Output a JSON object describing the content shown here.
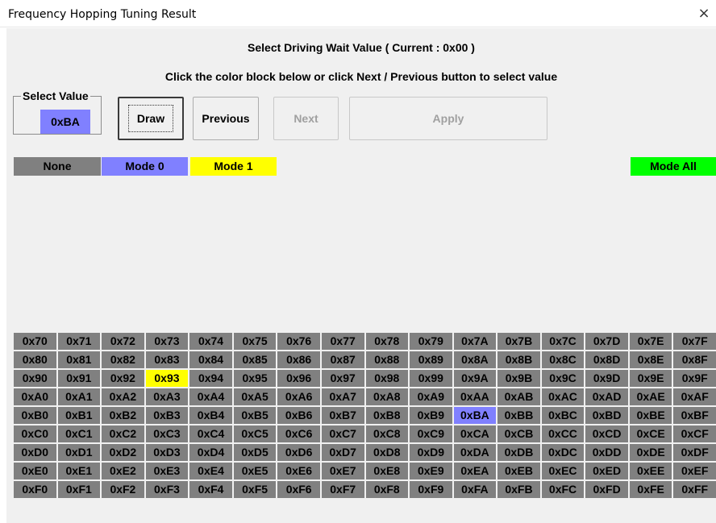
{
  "window": {
    "title": "Frequency Hopping Tuning Result",
    "close_glyph": "×"
  },
  "header": {
    "line1": "Select Driving Wait Value ( Current : 0x00 )",
    "line2": "Click the color block below or click Next / Previous button to select value"
  },
  "select_value": {
    "label": "Select Value",
    "value": "0xBA",
    "color": "#8080ff"
  },
  "buttons": {
    "draw": "Draw",
    "previous": "Previous",
    "next": "Next",
    "apply": "Apply",
    "next_enabled": false,
    "apply_enabled": false
  },
  "legend": {
    "none": {
      "label": "None",
      "color": "#808080"
    },
    "mode0": {
      "label": "Mode 0",
      "color": "#8080ff"
    },
    "mode1": {
      "label": "Mode 1",
      "color": "#ffff00"
    },
    "mode_all": {
      "label": "Mode All",
      "color": "#00ff00"
    }
  },
  "grid": {
    "rows": [
      [
        "0x70",
        "0x71",
        "0x72",
        "0x73",
        "0x74",
        "0x75",
        "0x76",
        "0x77",
        "0x78",
        "0x79",
        "0x7A",
        "0x7B",
        "0x7C",
        "0x7D",
        "0x7E",
        "0x7F"
      ],
      [
        "0x80",
        "0x81",
        "0x82",
        "0x83",
        "0x84",
        "0x85",
        "0x86",
        "0x87",
        "0x88",
        "0x89",
        "0x8A",
        "0x8B",
        "0x8C",
        "0x8D",
        "0x8E",
        "0x8F"
      ],
      [
        "0x90",
        "0x91",
        "0x92",
        "0x93",
        "0x94",
        "0x95",
        "0x96",
        "0x97",
        "0x98",
        "0x99",
        "0x9A",
        "0x9B",
        "0x9C",
        "0x9D",
        "0x9E",
        "0x9F"
      ],
      [
        "0xA0",
        "0xA1",
        "0xA2",
        "0xA3",
        "0xA4",
        "0xA5",
        "0xA6",
        "0xA7",
        "0xA8",
        "0xA9",
        "0xAA",
        "0xAB",
        "0xAC",
        "0xAD",
        "0xAE",
        "0xAF"
      ],
      [
        "0xB0",
        "0xB1",
        "0xB2",
        "0xB3",
        "0xB4",
        "0xB5",
        "0xB6",
        "0xB7",
        "0xB8",
        "0xB9",
        "0xBA",
        "0xBB",
        "0xBC",
        "0xBD",
        "0xBE",
        "0xBF"
      ],
      [
        "0xC0",
        "0xC1",
        "0xC2",
        "0xC3",
        "0xC4",
        "0xC5",
        "0xC6",
        "0xC7",
        "0xC8",
        "0xC9",
        "0xCA",
        "0xCB",
        "0xCC",
        "0xCD",
        "0xCE",
        "0xCF"
      ],
      [
        "0xD0",
        "0xD1",
        "0xD2",
        "0xD3",
        "0xD4",
        "0xD5",
        "0xD6",
        "0xD7",
        "0xD8",
        "0xD9",
        "0xDA",
        "0xDB",
        "0xDC",
        "0xDD",
        "0xDE",
        "0xDF"
      ],
      [
        "0xE0",
        "0xE1",
        "0xE2",
        "0xE3",
        "0xE4",
        "0xE5",
        "0xE6",
        "0xE7",
        "0xE8",
        "0xE9",
        "0xEA",
        "0xEB",
        "0xEC",
        "0xED",
        "0xEE",
        "0xEF"
      ],
      [
        "0xF0",
        "0xF1",
        "0xF2",
        "0xF3",
        "0xF4",
        "0xF5",
        "0xF6",
        "0xF7",
        "0xF8",
        "0xF9",
        "0xFA",
        "0xFB",
        "0xFC",
        "0xFD",
        "0xFE",
        "0xFF"
      ]
    ],
    "highlights": {
      "0x93": "mode1",
      "0xBA": "mode0"
    }
  }
}
